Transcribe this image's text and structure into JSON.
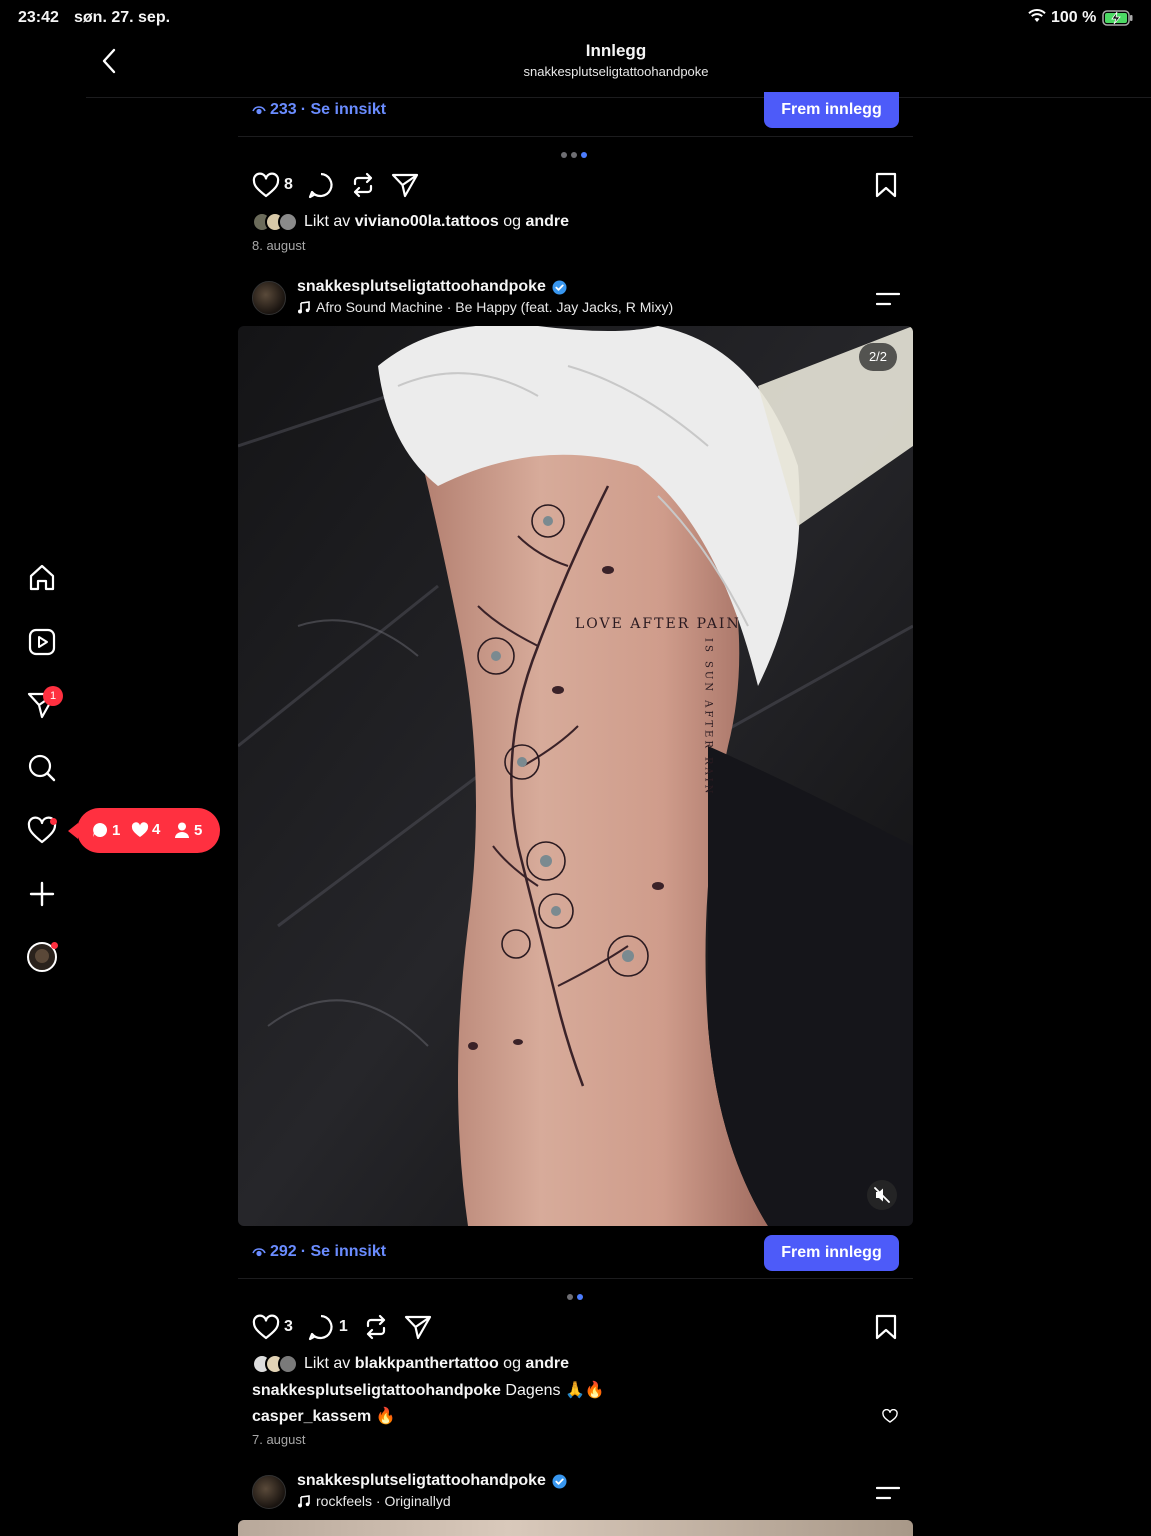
{
  "status_bar": {
    "time": "23:42",
    "date": "søn. 27. sep.",
    "battery_pct": "100 %"
  },
  "header": {
    "title": "Innlegg",
    "subtitle": "snakkesplutseligtattoohandpoke"
  },
  "sidebar": {
    "messages_badge": "1",
    "notifications": {
      "comments": "1",
      "likes": "4",
      "followers": "5"
    }
  },
  "posts": [
    {
      "insight": {
        "views": "233",
        "label": "· Se innsikt"
      },
      "promote_label": "Frem innlegg",
      "likes_count": "8",
      "liked_by": {
        "prefix": "Likt av",
        "user": "viviano00la.tattoos",
        "joiner": "og",
        "others": "andre"
      },
      "date": "8. august"
    },
    {
      "username": "snakkesplutseligtattoohandpoke",
      "music": "Afro Sound Machine · Be Happy (feat. Jay Jacks, R Mixy)",
      "carousel_counter": "2/2",
      "image": {
        "description": "tattoo photo",
        "tattoo_text": "LOVE AFTER PAIN",
        "tattoo_text_vertical": "IS SUN AFTER RAIN"
      },
      "insight": {
        "views": "292",
        "label": "· Se innsikt"
      },
      "promote_label": "Frem innlegg",
      "likes_count": "3",
      "comments_count": "1",
      "liked_by": {
        "prefix": "Likt av",
        "user": "blakkpanthertattoo",
        "joiner": "og",
        "others": "andre"
      },
      "caption": {
        "user": "snakkesplutseligtattoohandpoke",
        "text": "Dagens 🙏🔥"
      },
      "comment": {
        "user": "casper_kassem",
        "text": "🔥"
      },
      "date": "7. august"
    },
    {
      "username": "snakkesplutseligtattoohandpoke",
      "music": "rockfeels · Originallyd"
    }
  ],
  "colors": {
    "accent": "#4d5bf9",
    "link": "#6a8cff",
    "badge": "#ff3040",
    "verified": "#3897f0"
  }
}
